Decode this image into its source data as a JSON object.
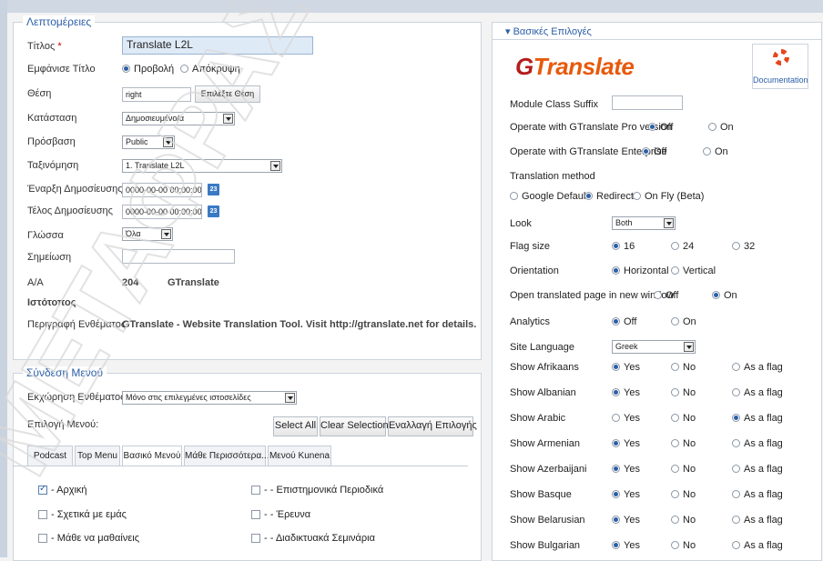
{
  "details": {
    "legend": "Λεπτομέρειες",
    "title_label": "Τίτλος",
    "required_mark": "*",
    "title_value": "Translate L2L",
    "show_title_label": "Εμφάνισε Τίτλο",
    "show_opt": "Προβολή",
    "hide_opt": "Απόκρυψη",
    "position_label": "Θέση",
    "position_value": "right",
    "position_button": "Επιλέξτε Θέση",
    "status_label": "Κατάσταση",
    "status_value": "Δημοσιευμένο/α",
    "access_label": "Πρόσβαση",
    "access_value": "Public",
    "ordering_label": "Ταξινόμηση",
    "ordering_value": "1. Translate L2L",
    "pub_start_label": "Έναρξη Δημοσίευσης",
    "pub_start_value": "0000-00-00 00:00:00",
    "pub_end_label": "Τέλος Δημοσίευσης",
    "pub_end_value": "0000-00-00 00:00:00",
    "calendar_icon_text": "23",
    "language_label": "Γλώσσα",
    "language_value": "Όλα",
    "note_label": "Σημείωση",
    "id_label": "Α/Α",
    "id_value": "204",
    "id_type": "GTranslate",
    "site_label": "Ιστότοπος",
    "desc_label": "Περιγραφή Ενθέματος",
    "desc_value": "GTranslate - Website Translation Tool. Visit http://gtranslate.net for details."
  },
  "menu": {
    "legend": "Σύνδεση Μενού",
    "assign_label": "Εκχώρηση Ενθέματος",
    "assign_value": "Μόνο στις επιλεγμένες ιστοσελίδες",
    "select_label": "Επιλογή Μενού:",
    "btn_select_all": "Select All",
    "btn_clear": "Clear Selection",
    "btn_toggle": "Εναλλαγή Επιλογής",
    "tabs": [
      "Podcast",
      "Top Menu",
      "Βασικό Μενού",
      "Μάθε Περισσότερα...",
      "Μενού Kunena"
    ],
    "items_left": [
      "- Αρχική",
      "- Σχετικά με εμάς",
      "- Μάθε να μαθαίνεις"
    ],
    "items_right": [
      "- - Επιστημονικά Περιοδικά",
      "- - Έρευνα",
      "- - Διαδικτυακά Σεμινάρια"
    ]
  },
  "basic": {
    "header": "▾ Βασικές Επιλογές",
    "logo_prefix": "G",
    "logo_text": "Translate",
    "doc_label": "Documentation",
    "suffix_label": "Module Class Suffix",
    "pro_label": "Operate with GTranslate Pro version",
    "ent_label": "Operate with GTranslate Enterprise",
    "off": "Off",
    "on": "On",
    "method_label": "Translation method",
    "method_google": "Google Default",
    "method_redirect": "Redirect",
    "method_onfly": "On Fly (Beta)",
    "look_label": "Look",
    "look_value": "Both",
    "flag_label": "Flag size",
    "flag_16": "16",
    "flag_24": "24",
    "flag_32": "32",
    "orient_label": "Orientation",
    "orient_h": "Horizontal",
    "orient_v": "Vertical",
    "newwin_label": "Open translated page in new window",
    "analytics_label": "Analytics",
    "sitelang_label": "Site Language",
    "sitelang_value": "Greek",
    "yes": "Yes",
    "no": "No",
    "flag": "As a flag",
    "languages": [
      "Show Afrikaans",
      "Show Albanian",
      "Show Arabic",
      "Show Armenian",
      "Show Azerbaijani",
      "Show Basque",
      "Show Belarusian",
      "Show Bulgarian"
    ]
  },
  "watermark": "ΜΕΤΑΦΡΑΣΤΗΣ"
}
